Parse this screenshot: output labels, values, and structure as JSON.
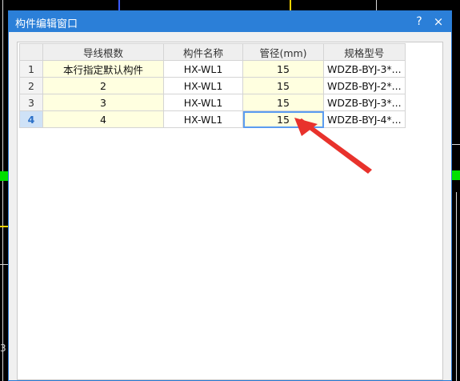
{
  "window": {
    "title": "构件编辑窗口",
    "help_label": "?",
    "close_label": "×"
  },
  "table": {
    "headers": [
      "",
      "导线根数",
      "构件名称",
      "管径(mm)",
      "规格型号"
    ],
    "rows": [
      {
        "num": "1",
        "wires": "本行指定默认构件",
        "name": "HX-WL1",
        "diameter": "15",
        "spec": "WDZB-BYJ-3*..."
      },
      {
        "num": "2",
        "wires": "2",
        "name": "HX-WL1",
        "diameter": "15",
        "spec": "WDZB-BYJ-2*..."
      },
      {
        "num": "3",
        "wires": "3",
        "name": "HX-WL1",
        "diameter": "15",
        "spec": "WDZB-BYJ-3*..."
      },
      {
        "num": "4",
        "wires": "4",
        "name": "HX-WL1",
        "diameter": "15",
        "spec": "WDZB-BYJ-4*..."
      }
    ]
  },
  "background": {
    "edge_text_left": "3"
  },
  "colors": {
    "titlebar": "#2b7fd8",
    "selected_header": "#8cbdf0",
    "cell_yellow": "#ffffe0",
    "arrow": "#e8322c"
  }
}
